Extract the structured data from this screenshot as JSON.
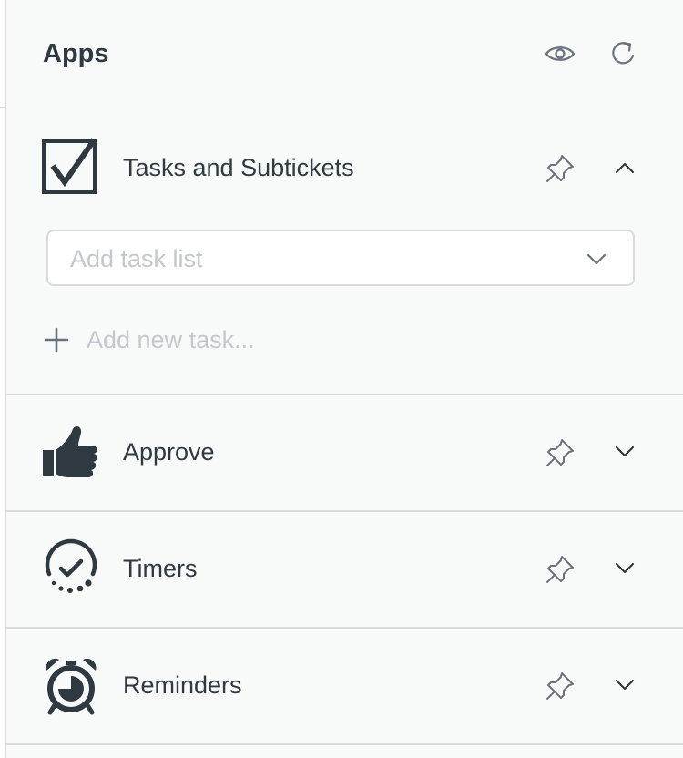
{
  "panel": {
    "title": "Apps",
    "header_icons": [
      "eye-icon",
      "refresh-icon"
    ]
  },
  "apps": [
    {
      "label": "Tasks and Subtickets",
      "icon": "checkbox-icon",
      "expanded": true,
      "task_list_placeholder": "Add task list",
      "add_task_placeholder": "Add new task..."
    },
    {
      "label": "Approve",
      "icon": "thumbs-up-icon",
      "expanded": false
    },
    {
      "label": "Timers",
      "icon": "timer-icon",
      "expanded": false
    },
    {
      "label": "Reminders",
      "icon": "alarm-clock-icon",
      "expanded": false
    }
  ],
  "colors": {
    "text": "#2f3941",
    "muted_icon": "#68737d",
    "placeholder": "#c2c8cc",
    "divider": "#d8dcde",
    "panel_bg": "#f8f9f9"
  }
}
